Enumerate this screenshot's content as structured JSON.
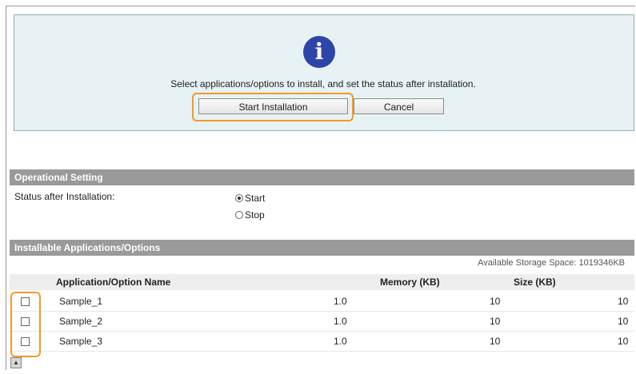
{
  "info": {
    "message": "Select applications/options to install, and set the status after installation.",
    "icon": "info-icon",
    "start_button": "Start Installation",
    "cancel_button": "Cancel"
  },
  "operational": {
    "header": "Operational Setting",
    "status_label": "Status after Installation:",
    "options": [
      "Start",
      "Stop"
    ],
    "selected": "Start"
  },
  "installable": {
    "header": "Installable Applications/Options",
    "storage": "Available Storage Space: 1019346KB",
    "columns": [
      "Application/Option Name",
      "Memory (KB)",
      "Size (KB)"
    ],
    "rows": [
      {
        "name": "Sample_1",
        "version": "1.0",
        "memory": "10",
        "size": "10"
      },
      {
        "name": "Sample_2",
        "version": "1.0",
        "memory": "10",
        "size": "10"
      },
      {
        "name": "Sample_3",
        "version": "1.0",
        "memory": "10",
        "size": "10"
      }
    ]
  },
  "colors": {
    "panel_bg": "#e7f2f4",
    "icon_blue": "#2f44a8",
    "section_bar": "#9a9a9a",
    "highlight": "#f39a27"
  }
}
